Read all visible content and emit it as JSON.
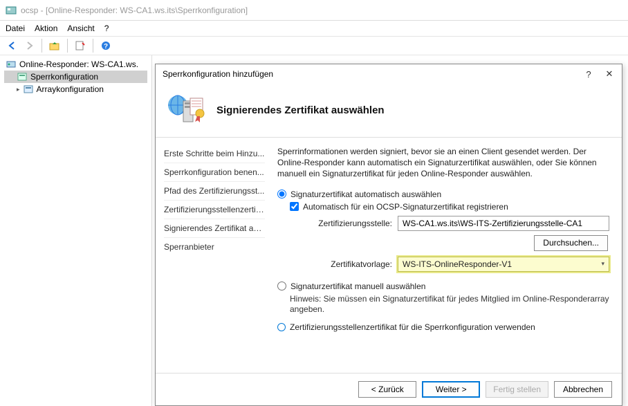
{
  "window": {
    "title": "ocsp - [Online-Responder: WS-CA1.ws.its\\Sperrkonfiguration]"
  },
  "menu": {
    "datei": "Datei",
    "aktion": "Aktion",
    "ansicht": "Ansicht",
    "help": "?"
  },
  "tree": {
    "root": "Online-Responder: WS-CA1.ws.",
    "sperrkonfig": "Sperrkonfiguration",
    "arraykonfig": "Arraykonfiguration"
  },
  "dialog": {
    "title": "Sperrkonfiguration hinzufügen",
    "header_title": "Signierendes Zertifikat auswählen",
    "nav": {
      "step1": "Erste Schritte beim Hinzu...",
      "step2": "Sperrkonfiguration benen...",
      "step3": "Pfad des Zertifizierungsst...",
      "step4": "Zertifizierungsstellenzertif...",
      "step5": "Signierendes Zertifikat au...",
      "step6": "Sperranbieter"
    },
    "intro": "Sperrinformationen werden signiert, bevor sie an einen Client gesendet werden. Der Online-Responder kann automatisch ein Signaturzertifikat auswählen, oder Sie können manuell ein Signaturzertifikat für jeden Online-Responder auswählen.",
    "opt_auto": "Signaturzertifikat automatisch auswählen",
    "chk_auto_enroll": "Automatisch für ein OCSP-Signaturzertifikat registrieren",
    "label_ca": "Zertifizierungsstelle:",
    "value_ca": "WS-CA1.ws.its\\WS-ITS-Zertifizierungsstelle-CA1",
    "btn_browse": "Durchsuchen...",
    "label_template": "Zertifikatvorlage:",
    "value_template": "WS-ITS-OnlineResponder-V1",
    "opt_manual": "Signaturzertifikat manuell auswählen",
    "hint_manual": "Hinweis: Sie müssen ein Signaturzertifikat für jedes Mitglied im Online-Responderarray angeben.",
    "opt_ca_cert": "Zertifizierungsstellenzertifikat für die Sperrkonfiguration verwenden",
    "btn_back": "<  Zurück",
    "btn_next": "Weiter  >",
    "btn_finish": "Fertig stellen",
    "btn_cancel": "Abbrechen"
  }
}
